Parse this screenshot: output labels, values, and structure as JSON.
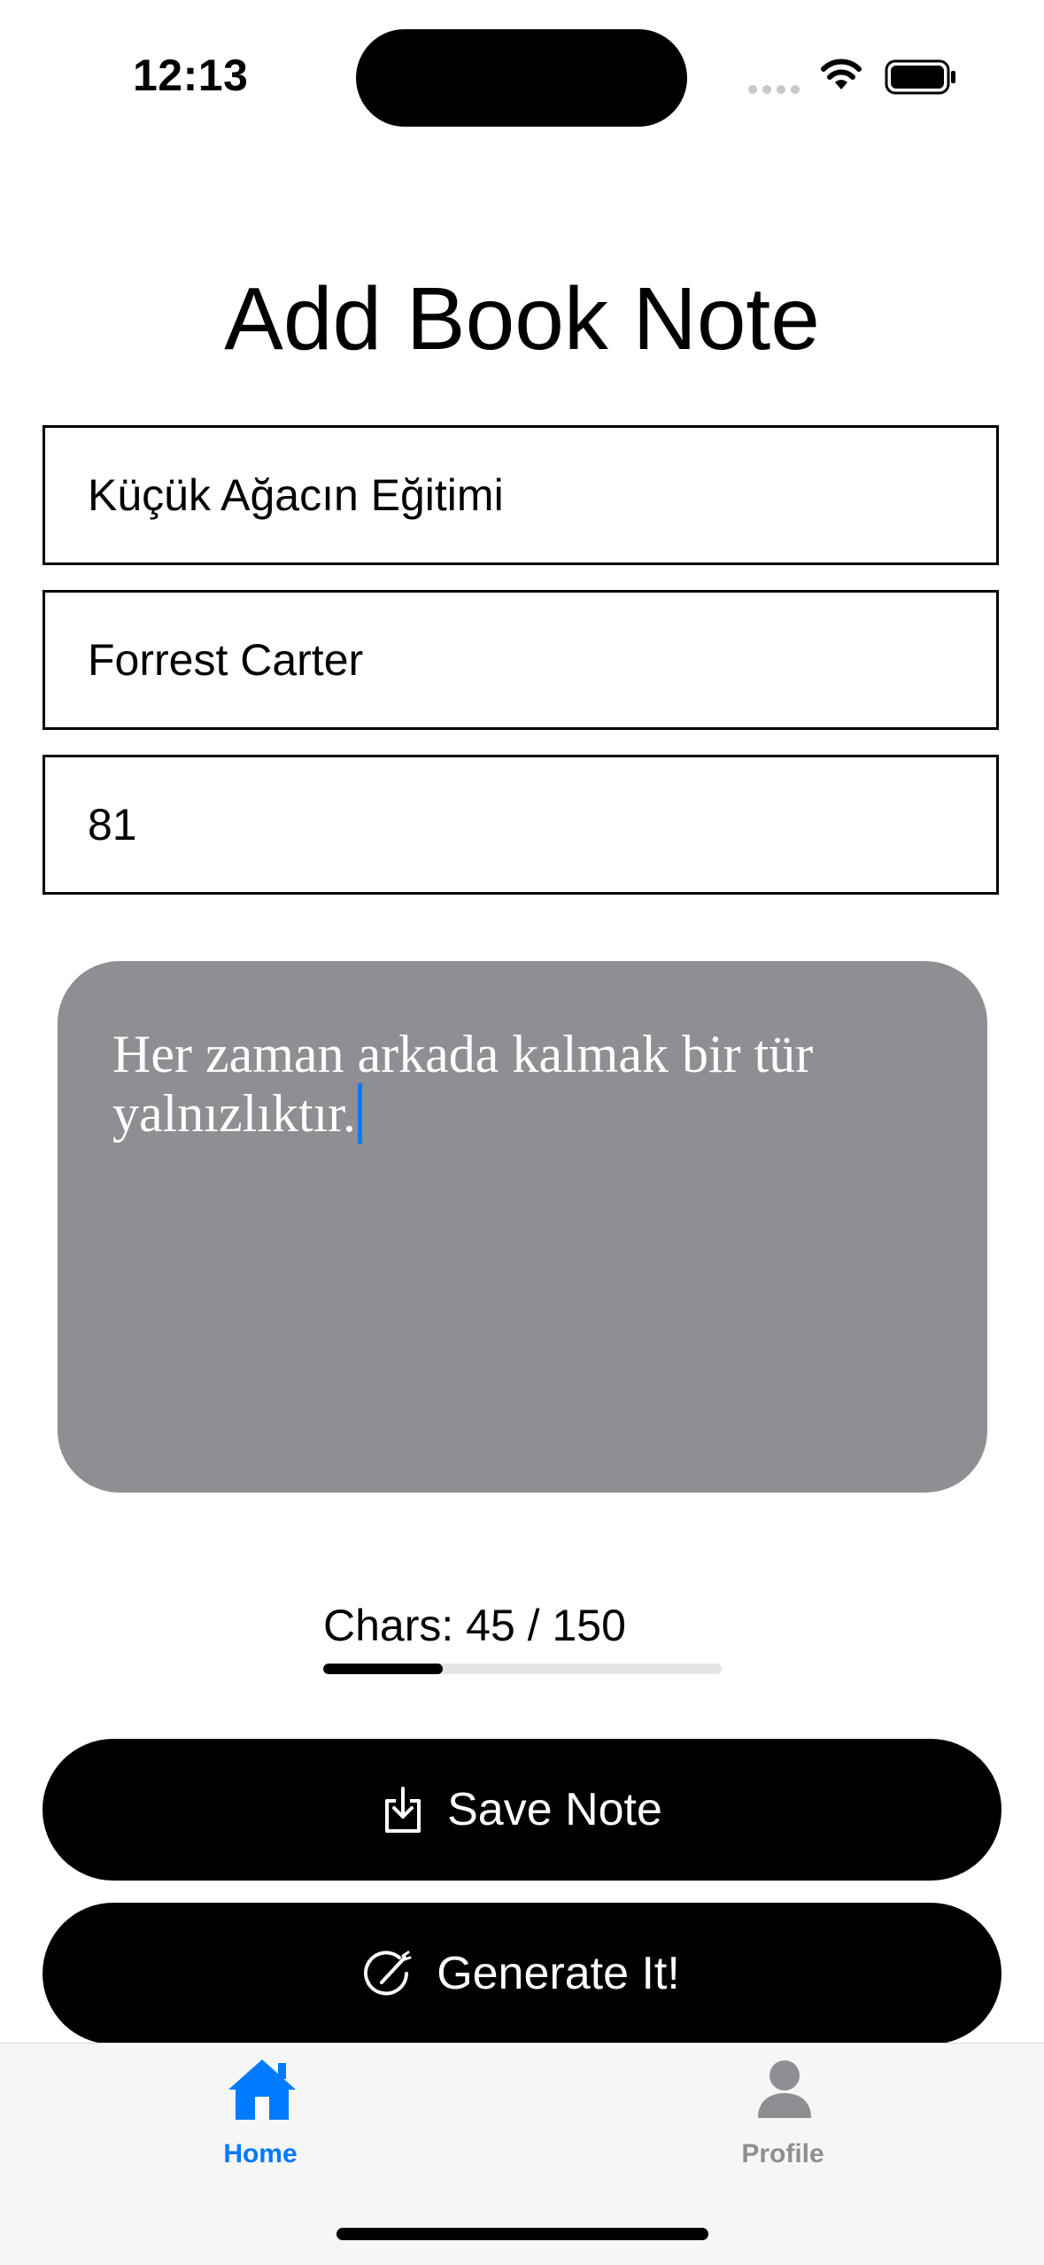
{
  "status_bar": {
    "time": "12:13"
  },
  "page": {
    "title": "Add Book Note"
  },
  "form": {
    "book_title": "Küçük Ağacın Eğitimi",
    "author": "Forrest Carter",
    "page_number": "81",
    "note": "Her zaman arkada kalmak bir tür yalnızlıktır."
  },
  "char_counter": {
    "label": "Chars: 45 / 150",
    "current": 45,
    "max": 150,
    "fill_fraction": 0.3
  },
  "buttons": {
    "save_label": "Save Note",
    "save_icon": "save-download-icon",
    "generate_label": "Generate It!",
    "generate_icon": "magic-wand-icon"
  },
  "tab_bar": {
    "items": [
      {
        "label": "Home",
        "icon": "home-icon",
        "active": true
      },
      {
        "label": "Profile",
        "icon": "person-icon",
        "active": false
      }
    ]
  },
  "colors": {
    "accent": "#007aff",
    "note_background": "#8e8e93",
    "inactive_tab": "#8e8e93"
  }
}
